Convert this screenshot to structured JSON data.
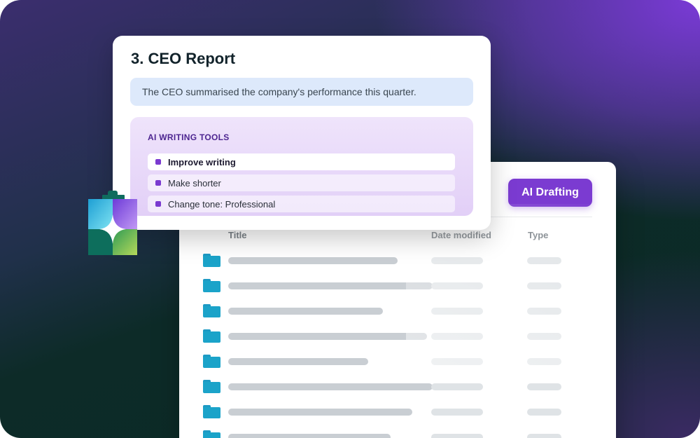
{
  "colors": {
    "accent_purple": "#7b3bd1",
    "folder_blue": "#1ba3c9",
    "summary_bg": "#dde9fb",
    "logo_green": "#0f6c5e"
  },
  "report": {
    "title": "3. CEO Report",
    "summary": "The CEO summarised the company's performance this quarter.",
    "tools": {
      "heading": "AI WRITING TOOLS",
      "items": [
        {
          "label": "Improve writing",
          "active": true
        },
        {
          "label": "Make shorter",
          "active": false
        },
        {
          "label": "Change tone: Professional",
          "active": false
        }
      ]
    }
  },
  "browser": {
    "button_label": "AI Drafting",
    "columns": [
      "Title",
      "Date modified",
      "Type"
    ],
    "row_icon": "folder-icon"
  },
  "logo_icon": "brand-logo-icon"
}
